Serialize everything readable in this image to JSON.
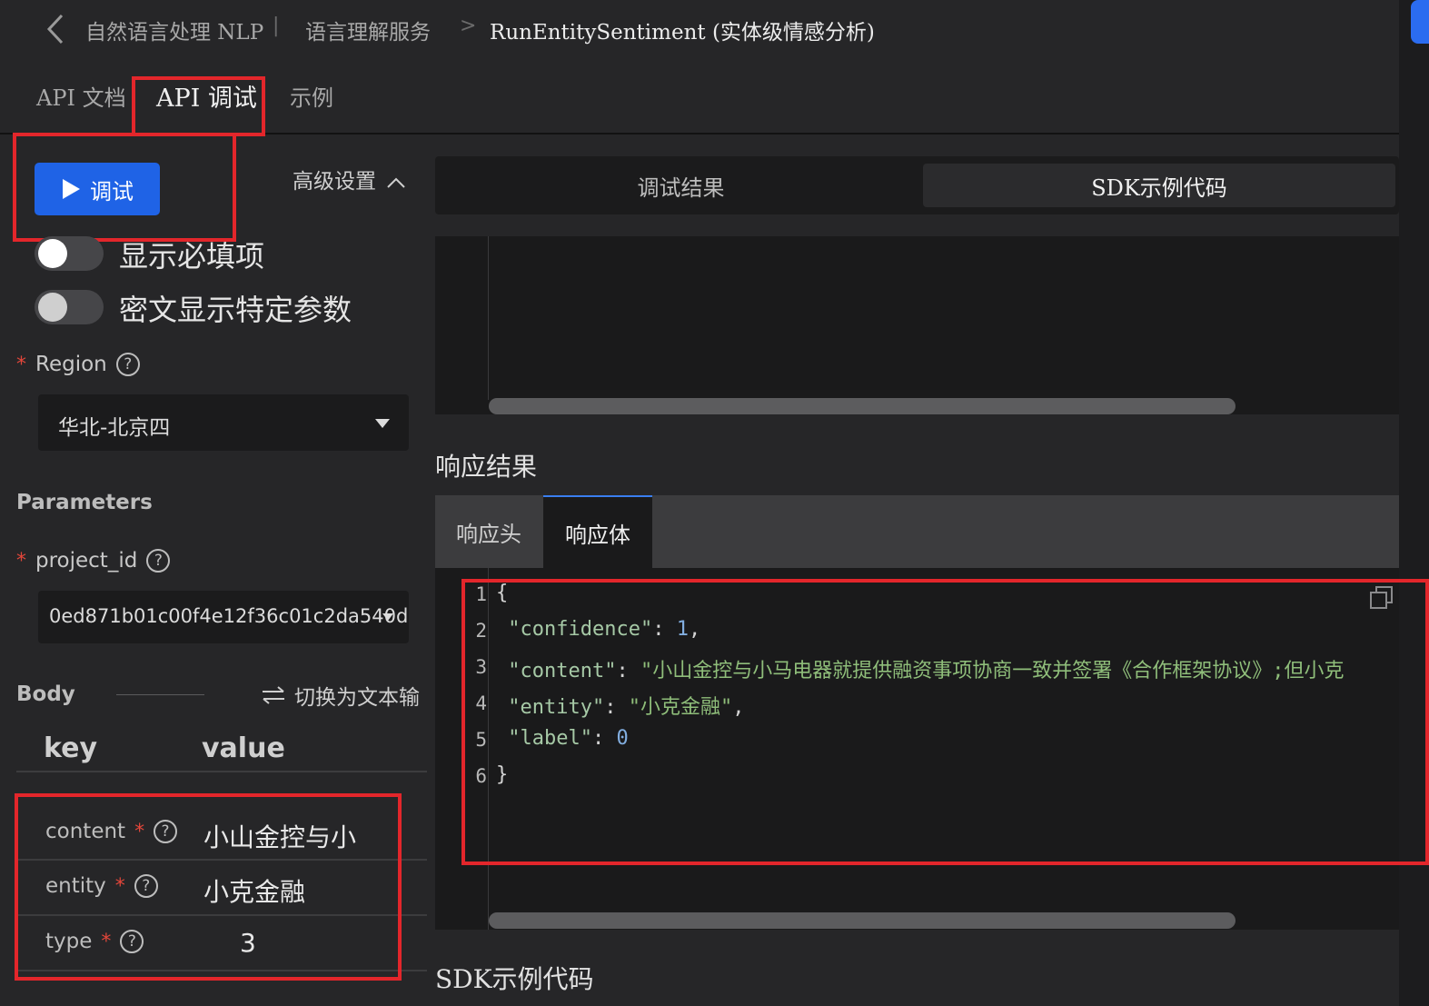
{
  "breadcrumb": {
    "item1": "自然语言处理 NLP",
    "sep1": "|",
    "item2": "语言理解服务",
    "sep2": ">",
    "current": "RunEntitySentiment (实体级情感分析)"
  },
  "tabs": {
    "doc": "API 文档",
    "debug": "API 调试",
    "example": "示例"
  },
  "actions": {
    "debug_button": "调试",
    "advanced_settings": "高级设置"
  },
  "toggles": {
    "show_required": "显示必填项",
    "mask_params": "密文显示特定参数"
  },
  "region": {
    "label": "Region",
    "required_mark": "*",
    "value": "华北-北京四"
  },
  "parameters": {
    "title": "Parameters",
    "project_id_label": "project_id",
    "required_mark": "*",
    "project_id_value": "0ed871b01c00f4e12f36c01c2da540d"
  },
  "body": {
    "title": "Body",
    "switch_text": "切换为文本输",
    "col_key": "key",
    "col_value": "value",
    "rows": [
      {
        "key": "content",
        "value": "小山金控与小"
      },
      {
        "key": "entity",
        "value": "小克金融"
      },
      {
        "key": "type",
        "value": "3"
      }
    ]
  },
  "right_tabs": {
    "result": "调试结果",
    "sdk": "SDK示例代码"
  },
  "response": {
    "title": "响应结果",
    "tab_headers": "响应头",
    "tab_body": "响应体",
    "line_numbers": [
      "1",
      "2",
      "3",
      "4",
      "5",
      "6"
    ],
    "json": {
      "open": "{",
      "confidence_key": "\"confidence\"",
      "confidence_val": "1",
      "content_key": "\"content\"",
      "content_val": "\"小山金控与小马电器就提供融资事项协商一致并签署《合作框架协议》;但小克",
      "entity_key": "\"entity\"",
      "entity_val": "\"小克金融\"",
      "label_key": "\"label\"",
      "label_val": "0",
      "close": "}"
    }
  },
  "sdk_section_title": "SDK示例代码",
  "colors": {
    "background": "#262628",
    "accent_blue": "#1f63e6",
    "highlight_red": "#e3262b",
    "required_red": "#e2463a"
  }
}
